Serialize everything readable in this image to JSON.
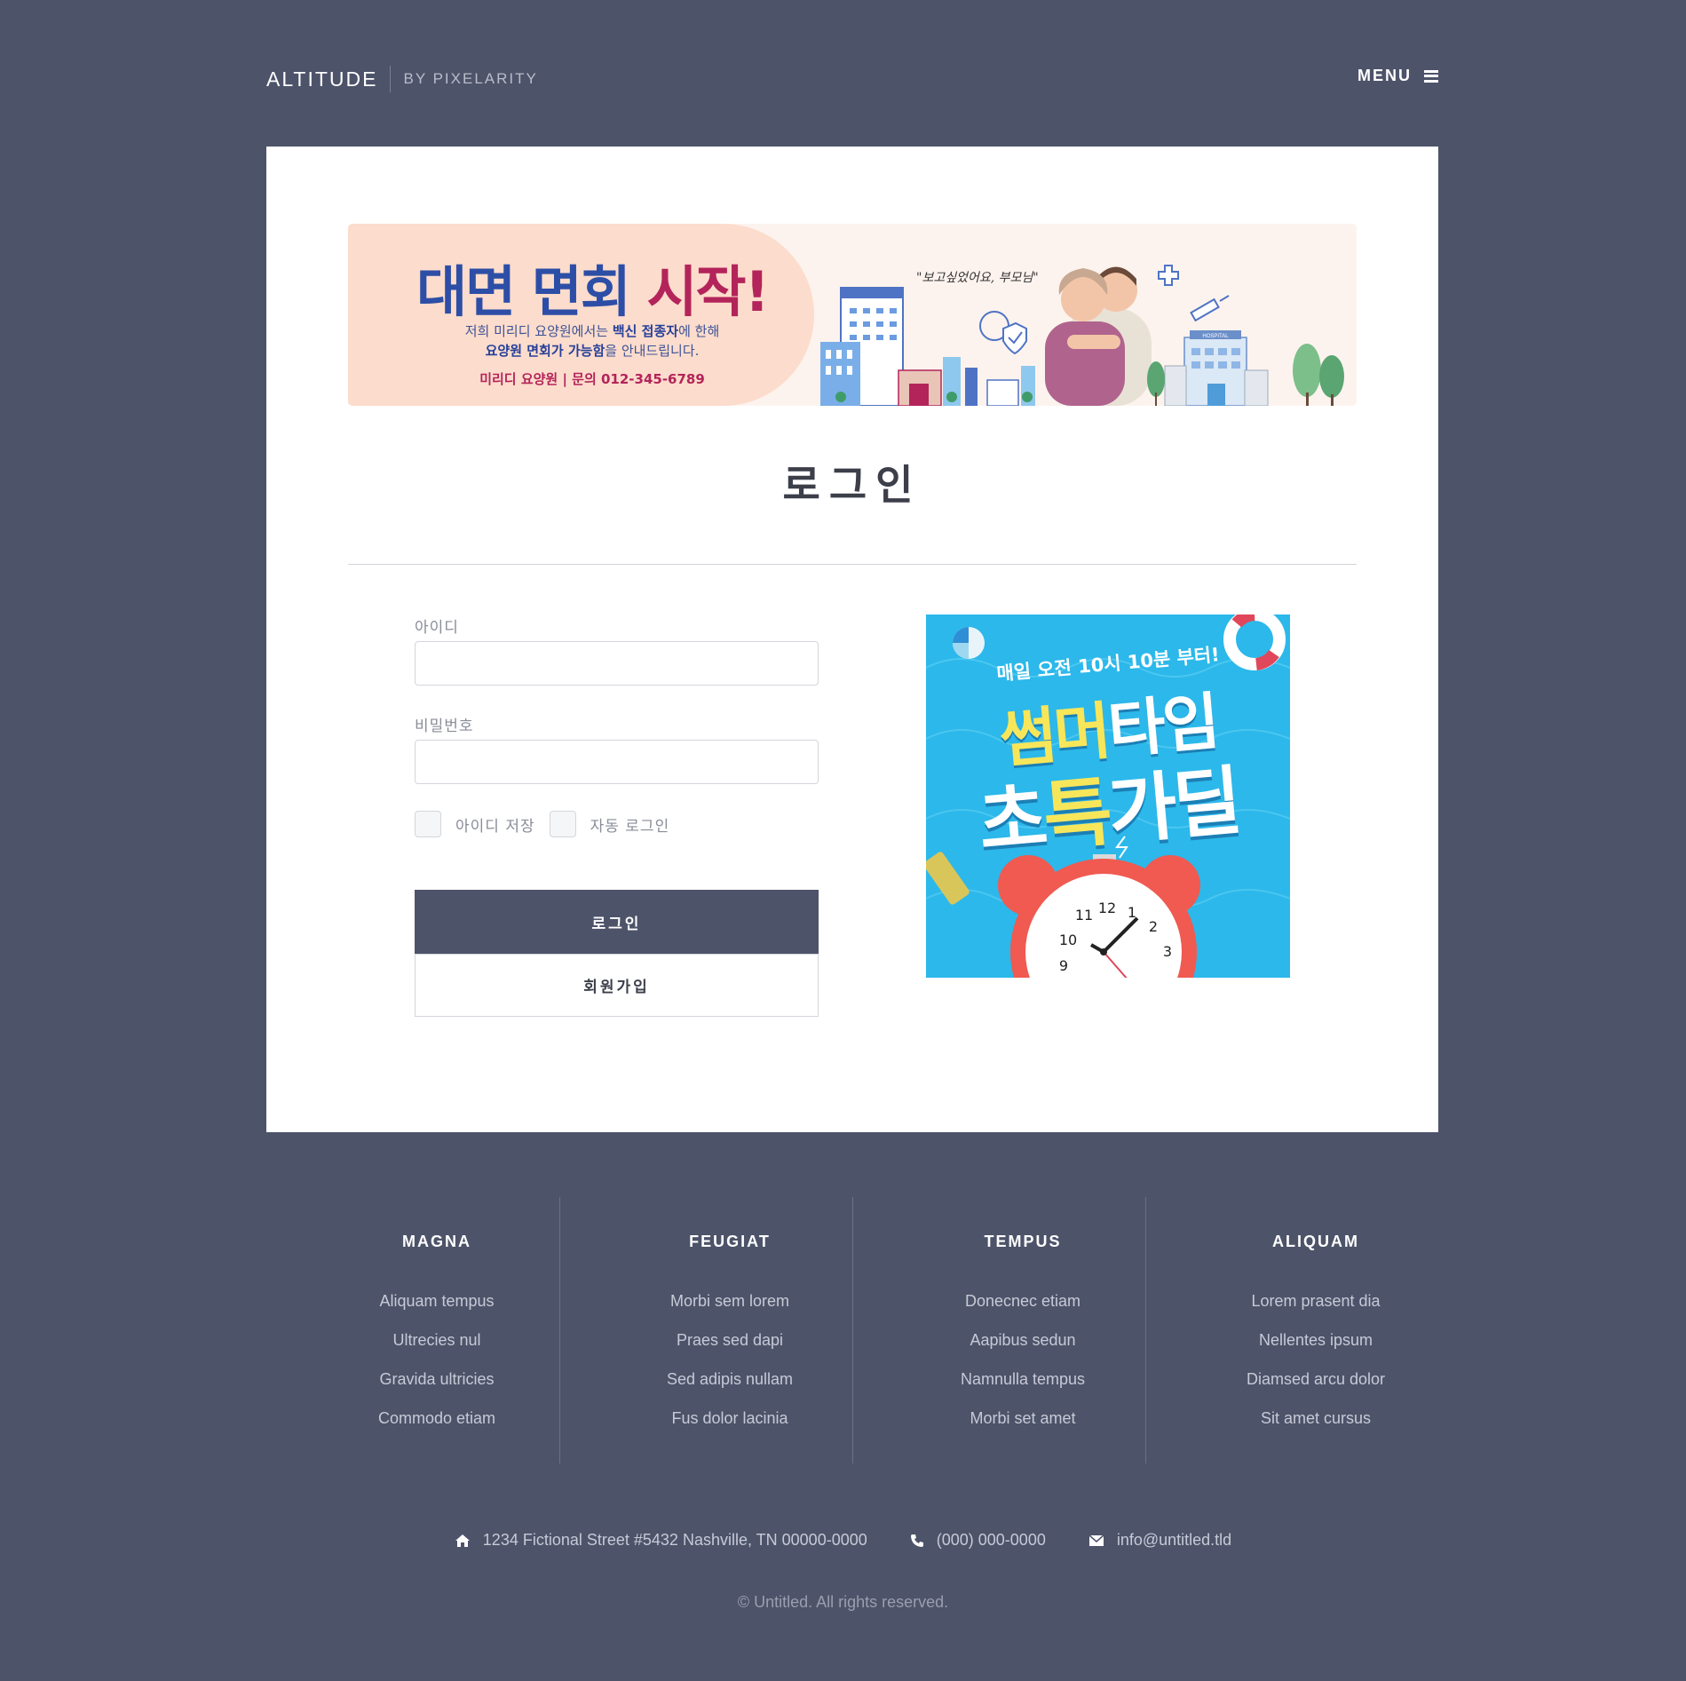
{
  "header": {
    "logo_main": "ALTITUDE",
    "logo_sub": "BY PIXELARITY",
    "menu_label": "MENU"
  },
  "banner": {
    "title_blue": "대면 면회 ",
    "title_red": "시작!",
    "line1_pre": "저희 미리디 요양원에서는 ",
    "line1_bold": "백신 접종자",
    "line1_post": "에 한해",
    "line2_bold": "요양원 면회가 가능함",
    "line2_post": "을 안내드립니다.",
    "contact": "미리디 요양원  |  문의 012-345-6789",
    "quote": "\"보고싶었어요, 부모님\"",
    "hospital_sign": "HOSPITAL"
  },
  "login": {
    "title": "로그인",
    "id_label": "아이디",
    "id_value": "",
    "password_label": "비밀번호",
    "password_value": "",
    "save_id_label": "아이디 저장",
    "auto_login_label": "자동 로그인",
    "login_button": "로그인",
    "join_button": "회원가입"
  },
  "promo": {
    "top": "매일 오전 10시 10분 부터!",
    "line1_yellow": "썸머",
    "line1_white": "타임",
    "line2_white": "초",
    "line2_yellow": "특",
    "line2_white2": "가딜",
    "clock_numbers": [
      "11",
      "12",
      "1",
      "2",
      "3",
      "10",
      "9"
    ]
  },
  "footer": {
    "columns": [
      {
        "title": "MAGNA",
        "items": [
          "Aliquam tempus",
          "Ultrecies nul",
          "Gravida ultricies",
          "Commodo etiam"
        ]
      },
      {
        "title": "FEUGIAT",
        "items": [
          "Morbi sem lorem",
          "Praes sed dapi",
          "Sed adipis nullam",
          "Fus dolor lacinia"
        ]
      },
      {
        "title": "TEMPUS",
        "items": [
          "Donecnec etiam",
          "Aapibus sedun",
          "Namnulla tempus",
          "Morbi set amet"
        ]
      },
      {
        "title": "ALIQUAM",
        "items": [
          "Lorem prasent dia",
          "Nellentes ipsum",
          "Diamsed arcu dolor",
          "Sit amet cursus"
        ]
      }
    ],
    "address": "1234 Fictional Street #5432 Nashville, TN 00000-0000",
    "phone": "(000) 000-0000",
    "email": "info@untitled.tld",
    "copyright": "© Untitled. All rights reserved."
  },
  "colors": {
    "background": "#4d5369",
    "panel": "#ffffff",
    "button": "#4d5369",
    "banner_blue": "#2d4ea6",
    "banner_red": "#b3245a",
    "promo_yellow": "#f8e65a"
  },
  "icons": [
    "menu-icon",
    "home-icon",
    "phone-icon",
    "envelope-icon"
  ]
}
